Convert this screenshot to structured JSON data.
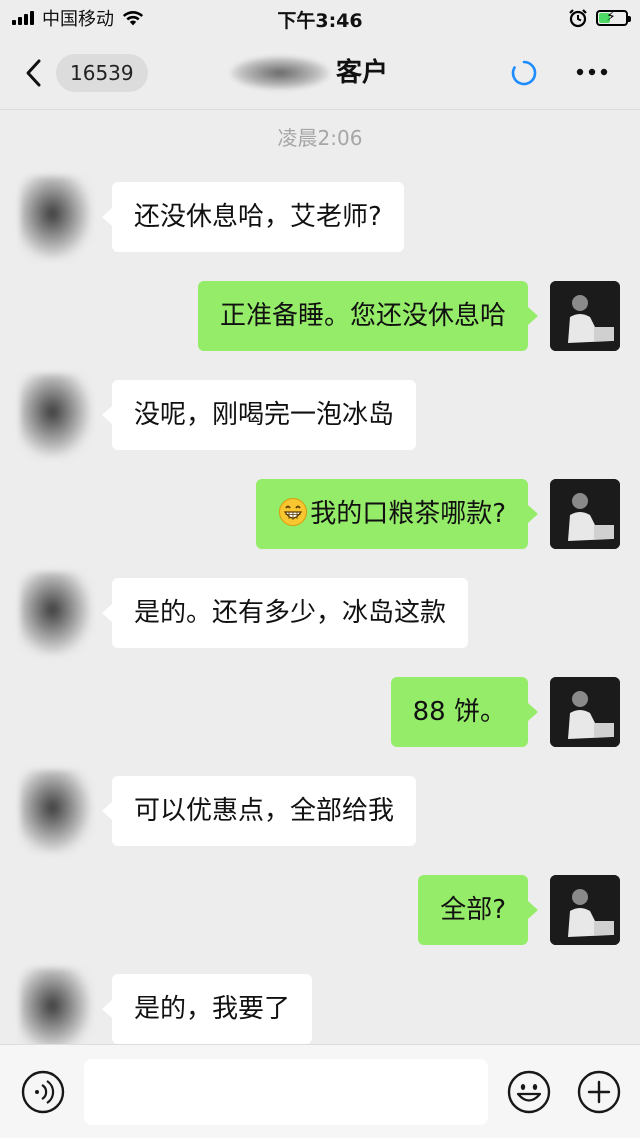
{
  "status_bar": {
    "carrier": "中国移动",
    "time": "下午3:46"
  },
  "nav": {
    "unread_count": "16539",
    "title": "客户"
  },
  "chat": {
    "timestamp": "凌晨2:06",
    "messages": [
      {
        "side": "in",
        "text": "还没休息哈，艾老师?"
      },
      {
        "side": "out",
        "text": "正准备睡。您还没休息哈"
      },
      {
        "side": "in",
        "text": "没呢，刚喝完一泡冰岛"
      },
      {
        "side": "out",
        "emoji": "grinning-face-emoji",
        "text": "我的口粮茶哪款?"
      },
      {
        "side": "in",
        "text": "是的。还有多少，冰岛这款"
      },
      {
        "side": "out",
        "text": "88 饼。"
      },
      {
        "side": "in",
        "text": "可以优惠点，全部给我"
      },
      {
        "side": "out",
        "text": "全部?"
      },
      {
        "side": "in",
        "text": "是的，我要了"
      }
    ]
  },
  "input_bar": {
    "placeholder": "",
    "value": ""
  },
  "colors": {
    "background": "#ededed",
    "outgoing_bubble": "#95ec69",
    "incoming_bubble": "#ffffff",
    "sync_accent": "#1e8cff"
  },
  "icons": [
    "back-icon",
    "sync-icon",
    "more-icon",
    "voice-icon",
    "emoji-icon",
    "plus-icon"
  ]
}
